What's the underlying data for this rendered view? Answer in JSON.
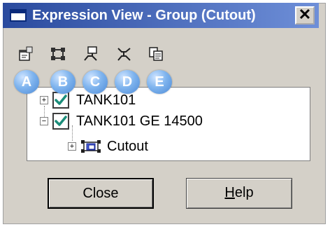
{
  "window": {
    "title": "Expression View - Group (Cutout)",
    "close_glyph": "✕"
  },
  "toolbar": {
    "items": [
      {
        "icon": "properties-icon",
        "badge": "A"
      },
      {
        "icon": "group-structure-icon",
        "badge": "B"
      },
      {
        "icon": "tree-expand-icon",
        "badge": "C"
      },
      {
        "icon": "tree-collapse-icon",
        "badge": "D"
      },
      {
        "icon": "copy-icon",
        "badge": "E"
      }
    ]
  },
  "tree": {
    "rows": [
      {
        "label": "TANK101",
        "expander": "+",
        "checked": true
      },
      {
        "label": "TANK101 GE 14500",
        "expander": "−",
        "checked": true
      },
      {
        "label": "Cutout",
        "expander": "+",
        "icon": "cutout-icon"
      }
    ]
  },
  "buttons": {
    "close": "Close",
    "help": "Help"
  },
  "colors": {
    "title_start": "#2a4a9e",
    "title_end": "#6e8fd8",
    "badge": "#5b95dc",
    "check": "#1b8e7a"
  }
}
